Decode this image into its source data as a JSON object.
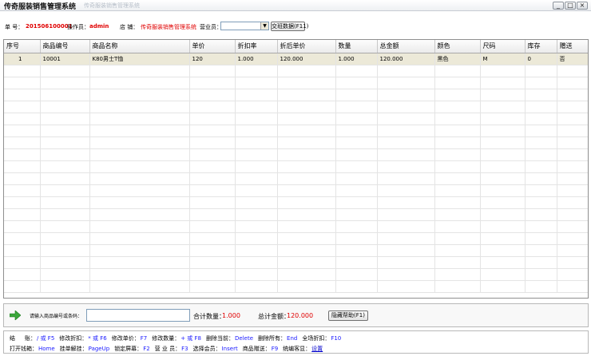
{
  "window": {
    "title": "传奇服装销售管理系统",
    "ghost_title": "传奇服装销售管理系统",
    "buttons": {
      "minimize": "_",
      "maximize": "□",
      "close": "×"
    }
  },
  "info": {
    "order_label": "单 号：",
    "order_no": "201506100001",
    "operator_label": "操作员：",
    "operator": "admin",
    "store_label": "店 铺：",
    "store": "传奇服装销售管理系统",
    "salesperson_label": "营业员：",
    "salesperson_value": "",
    "exchange_button": "交班数据(F11)"
  },
  "table": {
    "columns": [
      "序号",
      "商品编号",
      "商品名称",
      "单价",
      "折扣率",
      "折后单价",
      "数量",
      "总金额",
      "颜色",
      "尺码",
      "库存",
      "赠送"
    ],
    "rows": [
      [
        "1",
        "10001",
        "K80男士T恤",
        "120",
        "1.000",
        "120.000",
        "1.000",
        "120.000",
        "黑色",
        "M",
        "0",
        "否"
      ]
    ]
  },
  "entry": {
    "label": "请输入商品编号或条码：",
    "input_value": "",
    "total_qty_label": "合计数量：",
    "total_qty": "1.000",
    "total_amount_label": "总计金额：",
    "total_amount": "120.000",
    "hide_help_button": "隐藏帮助(F1)"
  },
  "help": {
    "line1": [
      {
        "t": "结",
        "c": "k"
      },
      {
        "t": "账：",
        "c": "k"
      },
      {
        "t": "/ 或 F5",
        "c": "b"
      },
      {
        "t": "修改折扣：",
        "c": "k"
      },
      {
        "t": "* 或 F6",
        "c": "b"
      },
      {
        "t": "修改单价：",
        "c": "k"
      },
      {
        "t": "F7",
        "c": "b"
      },
      {
        "t": "修改数量：",
        "c": "k"
      },
      {
        "t": "+ 或 F8",
        "c": "b"
      },
      {
        "t": "删除当前：",
        "c": "k"
      },
      {
        "t": "Delete",
        "c": "b"
      },
      {
        "t": "删除所有：",
        "c": "k"
      },
      {
        "t": "End",
        "c": "b"
      },
      {
        "t": "全场折扣：",
        "c": "k"
      },
      {
        "t": "F10",
        "c": "b"
      }
    ],
    "line2": [
      {
        "t": "打开钱箱：",
        "c": "k"
      },
      {
        "t": "Home",
        "c": "b"
      },
      {
        "t": "挂单解挂：",
        "c": "k"
      },
      {
        "t": "PageUp",
        "c": "b"
      },
      {
        "t": "锁定屏幕：",
        "c": "k"
      },
      {
        "t": "F2",
        "c": "b"
      },
      {
        "t": "营 业 员：",
        "c": "k"
      },
      {
        "t": "F3",
        "c": "b"
      },
      {
        "t": "选择会员：",
        "c": "k"
      },
      {
        "t": "Insert",
        "c": "b"
      },
      {
        "t": "商品赠送：",
        "c": "k"
      },
      {
        "t": "F9",
        "c": "b"
      },
      {
        "t": "统编客显：",
        "c": "k"
      },
      {
        "t": "设置",
        "c": "l"
      }
    ]
  }
}
